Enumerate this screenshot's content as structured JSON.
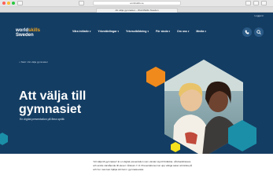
{
  "browser": {
    "url": "worldskills.se",
    "tab_title": "Att välja gymnasiet – WorldSkills Sweden"
  },
  "site": {
    "utility_link": "Logga in",
    "logo": {
      "line1_a": "world",
      "line1_b": "skills",
      "line2": "Sweden"
    },
    "nav": [
      {
        "label": "Våra initiativ"
      },
      {
        "label": "Yrkestävlingar"
      },
      {
        "label": "Yrkesutbildning"
      },
      {
        "label": "För skola"
      },
      {
        "label": "Om oss"
      },
      {
        "label": "Media"
      }
    ],
    "icons": {
      "phone": "phone-icon",
      "search": "search-icon"
    },
    "breadcrumb": {
      "home": "Start",
      "current": "Att välja gymnasiet"
    },
    "hero": {
      "title": "Att välja till gymnasiet",
      "subtitle": "En digital presentation på flera språk"
    },
    "intro_text": "”Att välja till gymnasiet” är en digital presentation som vänder sig till föräldrar, vårdnadshavare och andra närstående till elever i årskurs 7–9. Presentationen tar upp viktiga saker att tänka på och hur man kan hjälpa sitt barn i gymnasievalet."
  },
  "colors": {
    "hero_bg": "#143d63",
    "accent_orange": "#f08a1c",
    "accent_teal": "#1b8fa8",
    "accent_yellow": "#f5e21c"
  }
}
